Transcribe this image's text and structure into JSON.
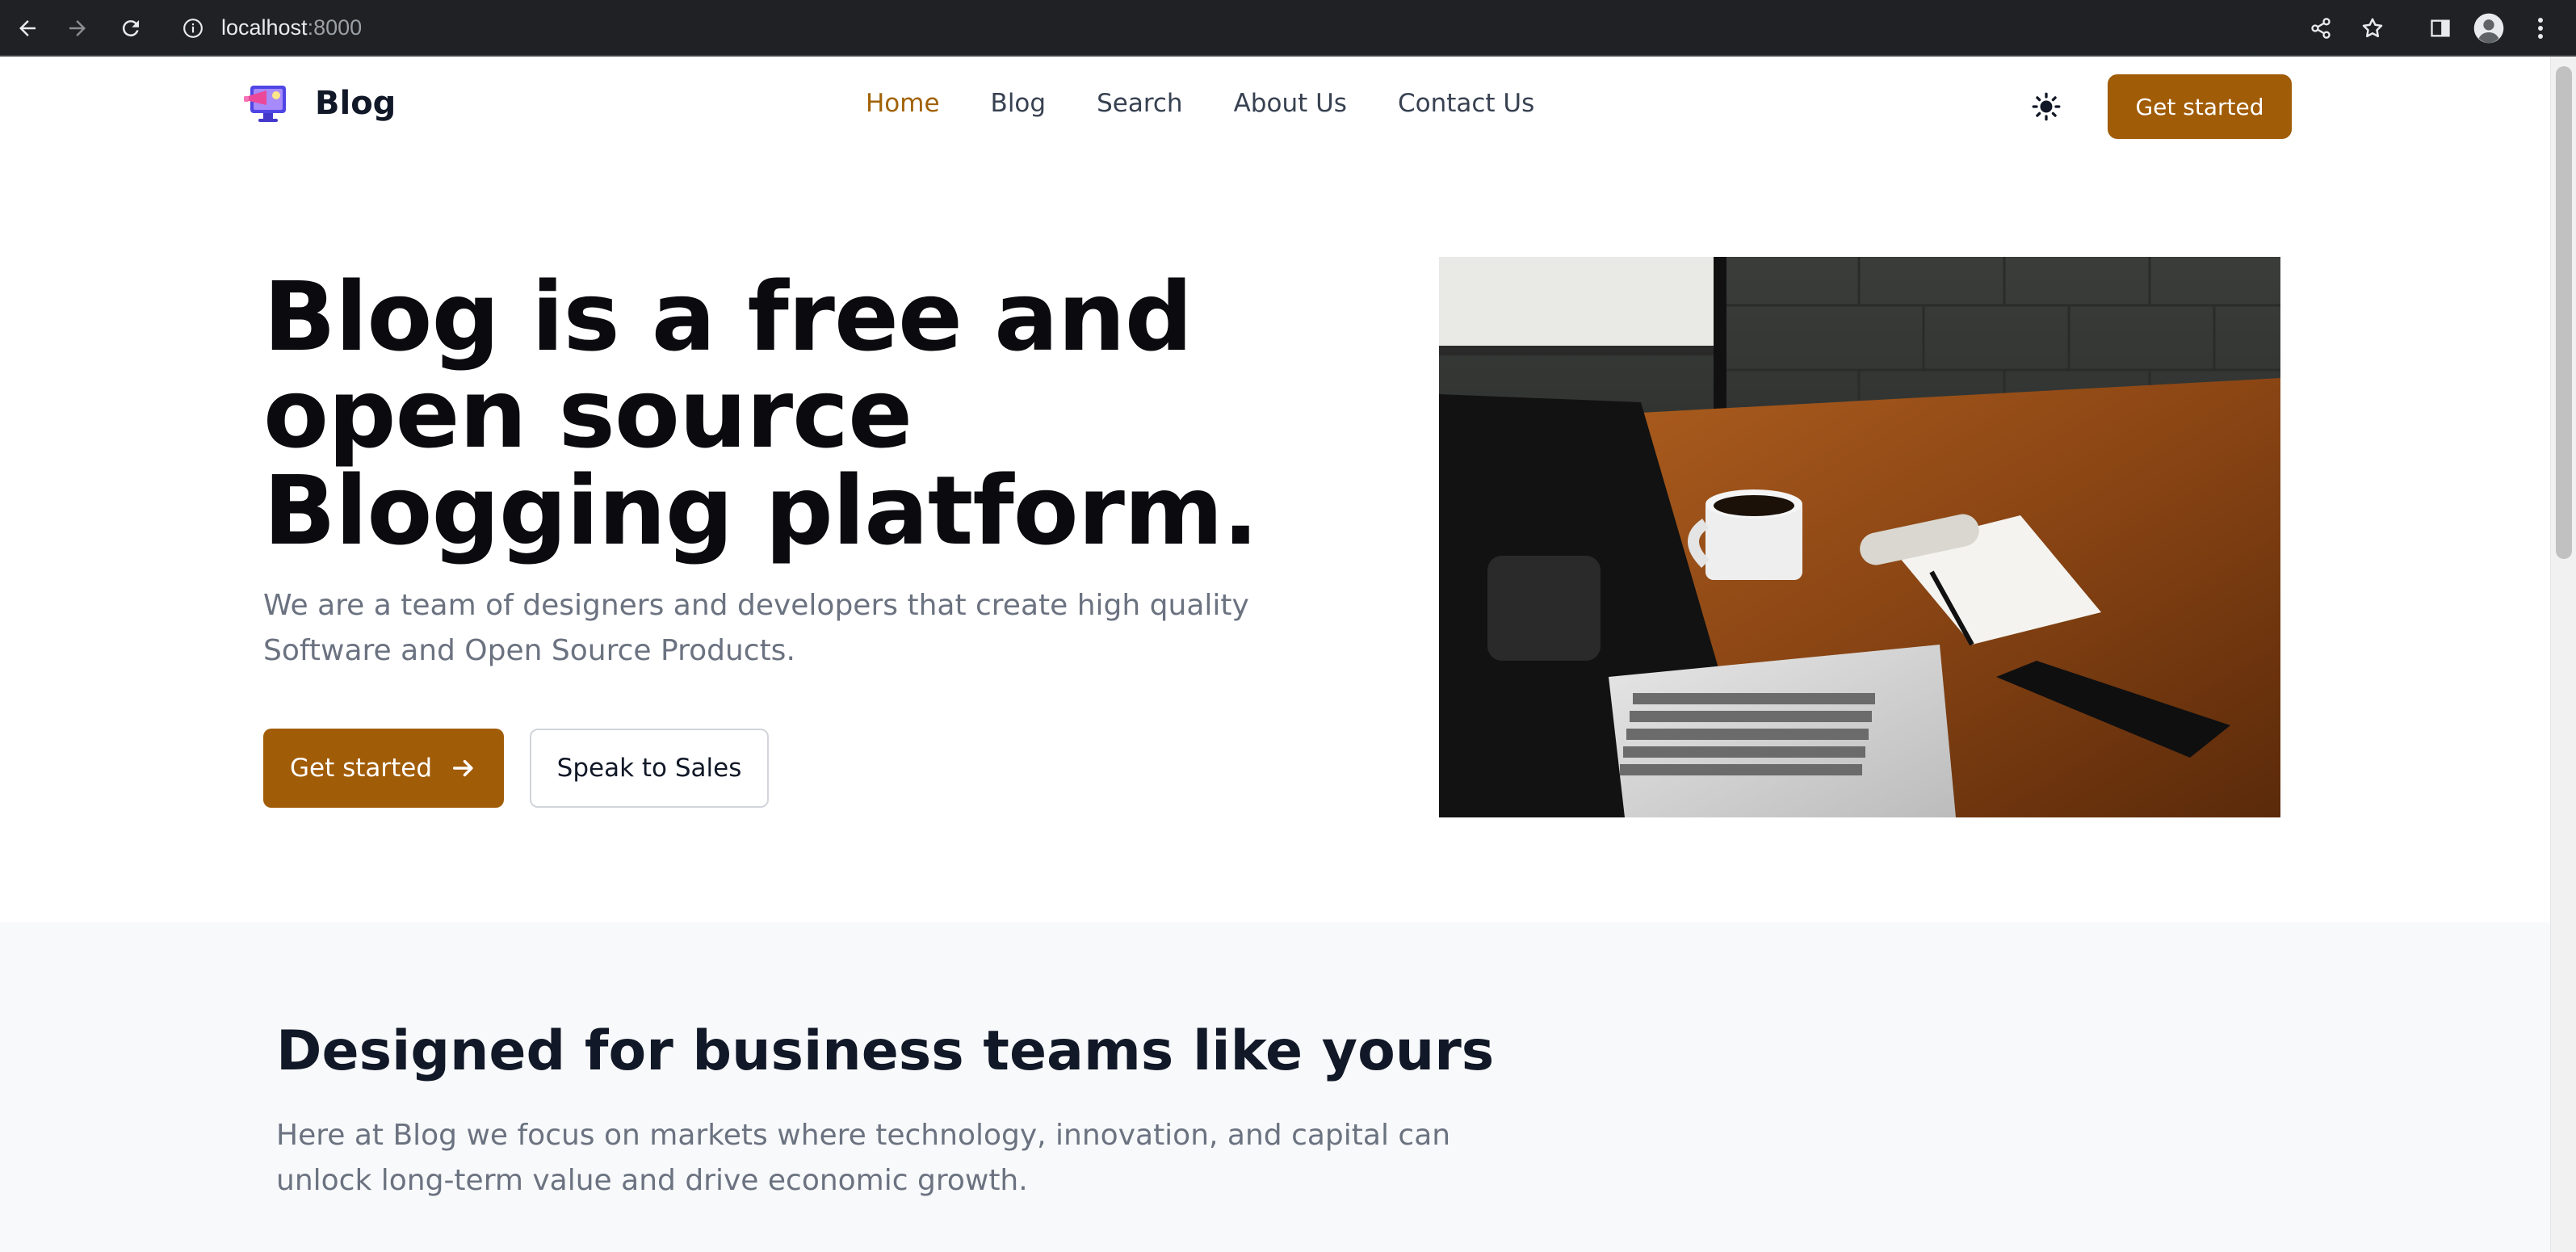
{
  "browser": {
    "url_host": "localhost",
    "url_port": ":8000",
    "icons": [
      "back-arrow-icon",
      "forward-arrow-icon",
      "reload-icon",
      "info-icon",
      "share-icon",
      "bookmark-star-icon",
      "side-panel-icon",
      "profile-avatar-icon",
      "kebab-menu-icon"
    ]
  },
  "header": {
    "brand": "Blog",
    "nav": [
      {
        "label": "Home",
        "active": true
      },
      {
        "label": "Blog",
        "active": false
      },
      {
        "label": "Search",
        "active": false
      },
      {
        "label": "About Us",
        "active": false
      },
      {
        "label": "Contact Us",
        "active": false
      }
    ],
    "theme_icon": "sun-icon",
    "cta_label": "Get started",
    "accent_color": "#a15c07"
  },
  "hero": {
    "title": "Blog is a free and open source Blogging platform.",
    "subtitle": "We are a team of designers and developers that create high quality Software and Open Source Products.",
    "primary_label": "Get started",
    "primary_icon": "arrow-right-icon",
    "secondary_label": "Speak to Sales"
  },
  "features": {
    "title": "Designed for business teams like yours",
    "subtitle": "Here at Blog we focus on markets where technology, innovation, and capital can unlock long-term value and drive economic growth."
  }
}
